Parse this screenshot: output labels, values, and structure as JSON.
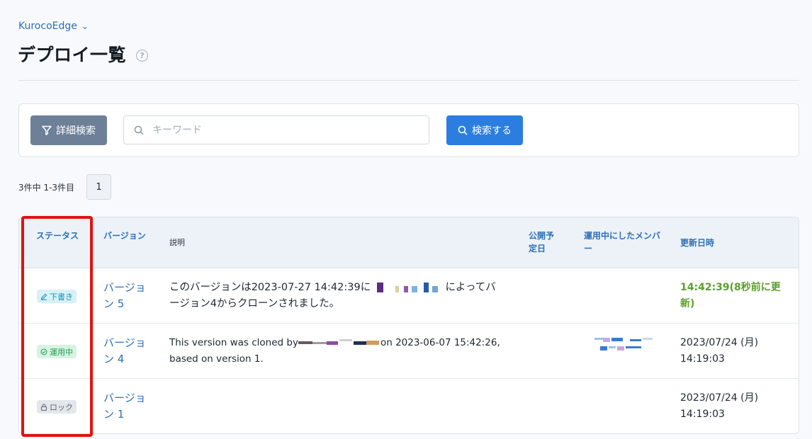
{
  "breadcrumb": {
    "label": "KurocoEdge"
  },
  "page": {
    "title": "デプロイ一覧",
    "help": "?"
  },
  "search": {
    "advanced_label": "詳細検索",
    "keyword_placeholder": "キーワード",
    "keyword_value": "",
    "submit_label": "検索する"
  },
  "pagination": {
    "summary": "3件中 1-3件目",
    "current_page": "1"
  },
  "table": {
    "headers": {
      "status": "ステータス",
      "version": "バージョン",
      "description": "説明",
      "scheduled": "公開予定日",
      "member": "運用中にしたメンバー",
      "updated": "更新日時"
    },
    "rows": [
      {
        "status": "下書き",
        "status_type": "draft",
        "version": "バージョン 5",
        "description_a": "このバージョンは2023-07-27 14:42:39に",
        "description_b": "によってバ",
        "description_c": "ージョン4からクローンされました。",
        "scheduled": "",
        "updated": "14:42:39(8秒前に更新)"
      },
      {
        "status": "運用中",
        "status_type": "active",
        "version": "バージョン 4",
        "description_a": "This version was cloned by",
        "description_b": "on 2023-06-07 15:42:26,",
        "description_c": "based on version 1.",
        "scheduled": "",
        "updated": "2023/07/24 (月) 14:19:03"
      },
      {
        "status": "ロック",
        "status_type": "locked",
        "version": "バージョン 1",
        "description_a": "",
        "scheduled": "",
        "updated": "2023/07/24 (月) 14:19:03"
      }
    ]
  },
  "colors": {
    "accent": "#2b7de0",
    "highlight": "#e0130f",
    "update_fresh": "#5aa02c"
  }
}
